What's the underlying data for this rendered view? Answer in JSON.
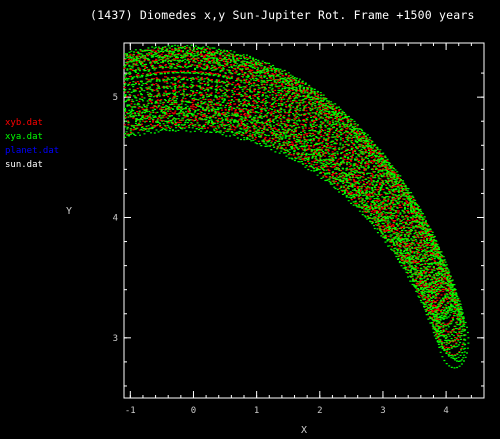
{
  "chart_data": {
    "type": "scatter",
    "title": "(1437) Diomedes x,y Sun-Jupiter Rot. Frame +1500 years",
    "xlabel": "X",
    "ylabel": "Y",
    "xlim": [
      -1.1,
      4.6
    ],
    "ylim": [
      2.5,
      5.45
    ],
    "xticks": [
      -1,
      0,
      1,
      2,
      3,
      4
    ],
    "yticks": [
      3,
      4,
      5
    ],
    "grid": false,
    "legend_position": "left",
    "legend": [
      {
        "name": "xyb.dat",
        "color": "#ff0000"
      },
      {
        "name": "xya.dat",
        "color": "#00ff00"
      },
      {
        "name": "planet.dat",
        "color": "#0000ff"
      },
      {
        "name": "sun.dat",
        "color": "#ffffff"
      }
    ],
    "series": [
      {
        "name": "xyb.dat",
        "color": "#ff0000",
        "arc_center": [
          -0.2,
          2.0
        ],
        "arc_radius_x": 4.6,
        "arc_radius_y": 3.2,
        "arc_angle_range_deg": [
          22,
          101
        ],
        "loop_radius": [
          0.32,
          0.28
        ],
        "loops": 120,
        "points_per_loop": 32
      },
      {
        "name": "xya.dat",
        "color": "#00ff00",
        "arc_center": [
          -0.2,
          2.0
        ],
        "arc_radius_x": 4.6,
        "arc_radius_y": 3.2,
        "arc_angle_range_deg": [
          20,
          106
        ],
        "loop_radius": [
          0.35,
          0.3
        ],
        "loops": 140,
        "points_per_loop": 36
      }
    ]
  }
}
